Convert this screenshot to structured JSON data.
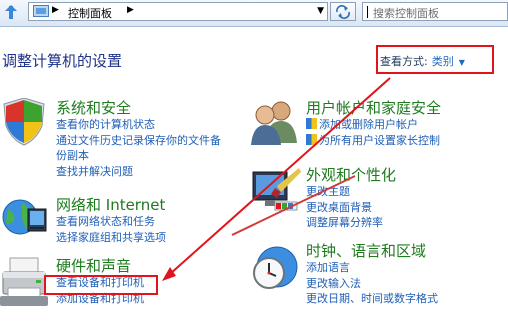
{
  "address_bar": {
    "breadcrumb": "控制面板",
    "search_placeholder": "搜索控制面板"
  },
  "header": {
    "title": "调整计算机的设置",
    "view_by_label": "查看方式:",
    "view_by_value": "类别"
  },
  "categories": {
    "system_security": {
      "title": "系统和安全",
      "links": [
        "查看你的计算机状态",
        "通过文件历史记录保存你的文件备",
        "份副本",
        "查找并解决问题"
      ]
    },
    "network": {
      "title": "网络和 Internet",
      "links": [
        "查看网络状态和任务",
        "选择家庭组和共享选项"
      ]
    },
    "hardware": {
      "title": "硬件和声音",
      "links": [
        "查看设备和打印机",
        "添加设备和打印机"
      ]
    },
    "user_accounts": {
      "title": "用户帐户和家庭安全",
      "links": [
        "添加或删除用户帐户",
        "为所有用户设置家长控制"
      ]
    },
    "appearance": {
      "title": "外观和个性化",
      "links": [
        "更改主题",
        "更改桌面背景",
        "调整屏幕分辨率"
      ]
    },
    "clock_region": {
      "title": "时钟、语言和区域",
      "links": [
        "添加语言",
        "更改输入法",
        "更改日期、时间或数字格式"
      ]
    }
  },
  "annotation_color": "#e0151b",
  "link_color": "#1f5fb6",
  "category_color": "#1e7b1e"
}
